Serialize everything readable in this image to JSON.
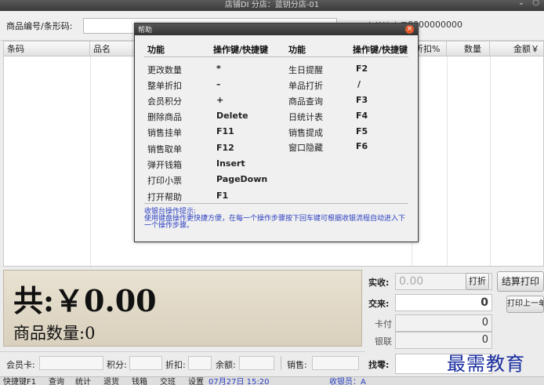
{
  "window": {
    "title": "店铺DI 分店：蓝钥分店-01",
    "min_btn": "⌄",
    "close_btn": "○"
  },
  "search": {
    "label": "商品编号/条形码:",
    "value": "",
    "order_label": "本单流水号:",
    "order_no": "0000000000"
  },
  "grid": {
    "columns": [
      "条码",
      "品名",
      "",
      "",
      "",
      "",
      "折扣%",
      "数量",
      "金额￥"
    ]
  },
  "totals": {
    "total_text": "共:￥0.00",
    "qty_text": "商品数量:0"
  },
  "payment": {
    "received_label": "实收:",
    "received_placeholder": "0.00",
    "discount_btn": "打折",
    "paid_label": "交来:",
    "paid_value": "0",
    "card_label": "卡付",
    "card_value": "0",
    "unionpay_label": "银联",
    "unionpay_value": "0",
    "change_label": "找零:",
    "change_value": "",
    "settle_print_btn": "结算打印",
    "print_prev_btn": "打印上一单"
  },
  "info": {
    "member_label": "会员卡:",
    "points_label": "积分:",
    "discount_label": "折扣:",
    "balance_label": "余额:",
    "sales_label": "销售:"
  },
  "statusbar": {
    "items": [
      "快捷键F1",
      "查询",
      "统计",
      "退货",
      "钱箱",
      "交班",
      "设置"
    ],
    "datetime": "07月27日 15:20",
    "cashier": "收银员：A"
  },
  "help_dialog": {
    "title": "帮助",
    "close": "×",
    "headers": {
      "func": "功能",
      "key": "操作键/快捷键",
      "func2": "功能",
      "key2": "操作键/快捷键"
    },
    "left": [
      {
        "func": "更改数量",
        "key": "*"
      },
      {
        "func": "整单折扣",
        "key": "–"
      },
      {
        "func": "会员积分",
        "key": "+"
      },
      {
        "func": "删除商品",
        "key": "Delete"
      },
      {
        "func": "销售挂单",
        "key": "F11"
      },
      {
        "func": "销售取单",
        "key": "F12"
      },
      {
        "func": "弹开钱箱",
        "key": "Insert"
      },
      {
        "func": "打印小票",
        "key": "PageDown"
      },
      {
        "func": "打开帮助",
        "key": "F1"
      }
    ],
    "right": [
      {
        "func": "生日提醒",
        "key": "F2"
      },
      {
        "func": "单品打折",
        "key": "/"
      },
      {
        "func": "商品查询",
        "key": "F3"
      },
      {
        "func": "日统计表",
        "key": "F4"
      },
      {
        "func": "销售提成",
        "key": "F5"
      },
      {
        "func": "窗口隐藏",
        "key": "F6"
      }
    ],
    "tip_title": "收银台操作提示:",
    "tip_body": "使用键盘操作更快捷方便，在每一个操作步骤按下回车键可根据收银流程自动进入下一个操作步骤。"
  },
  "watermark": "最需教育"
}
